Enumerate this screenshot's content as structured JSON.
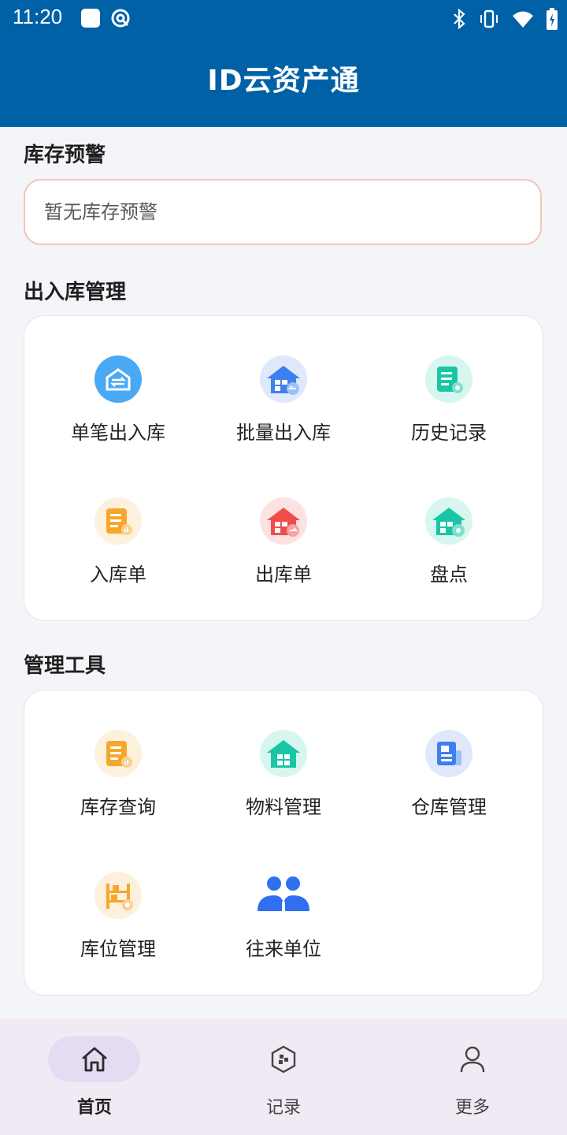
{
  "status_bar": {
    "time": "11:20",
    "icons_left": [
      "square-icon",
      "at-icon"
    ],
    "icons_right": [
      "bluetooth-icon",
      "vibrate-icon",
      "wifi-icon",
      "battery-icon"
    ]
  },
  "header": {
    "title": "ID云资产通"
  },
  "inventory_alert": {
    "title": "库存预警",
    "message": "暂无库存预警"
  },
  "inout": {
    "title": "出入库管理",
    "items": [
      {
        "label": "单笔出入库",
        "icon": "warehouse-exchange-icon",
        "color": "#4aa9f5"
      },
      {
        "label": "批量出入库",
        "icon": "batch-warehouse-icon",
        "color": "#3f7ff0"
      },
      {
        "label": "历史记录",
        "icon": "history-doc-icon",
        "color": "#18c6a6"
      },
      {
        "label": "入库单",
        "icon": "inbound-doc-icon",
        "color": "#f6a72b"
      },
      {
        "label": "出库单",
        "icon": "outbound-warehouse-icon",
        "color": "#f04c4c"
      },
      {
        "label": "盘点",
        "icon": "stocktake-warehouse-icon",
        "color": "#18c6a6"
      }
    ]
  },
  "tools": {
    "title": "管理工具",
    "items": [
      {
        "label": "库存查询",
        "icon": "inventory-query-icon",
        "color": "#f6a72b"
      },
      {
        "label": "物料管理",
        "icon": "material-warehouse-icon",
        "color": "#18c6a6"
      },
      {
        "label": "仓库管理",
        "icon": "warehouse-doc-icon",
        "color": "#3f7ff0"
      },
      {
        "label": "库位管理",
        "icon": "location-shelf-icon",
        "color": "#f6a72b"
      },
      {
        "label": "往来单位",
        "icon": "partners-icon",
        "color": "#2f6ff0"
      }
    ]
  },
  "bottom_nav": {
    "items": [
      {
        "label": "首页",
        "icon": "home-icon",
        "active": true
      },
      {
        "label": "记录",
        "icon": "records-icon",
        "active": false
      },
      {
        "label": "更多",
        "icon": "person-icon",
        "active": false
      }
    ]
  }
}
